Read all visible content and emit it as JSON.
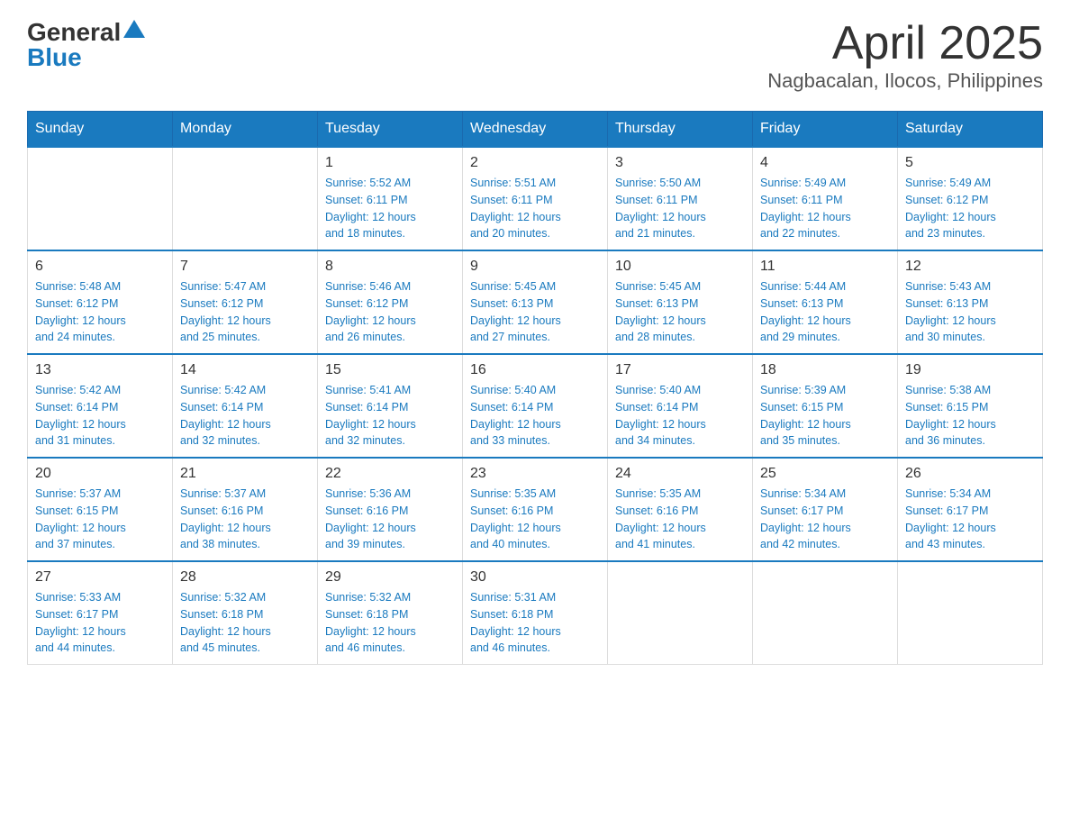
{
  "header": {
    "logo_general": "General",
    "logo_blue": "Blue",
    "title": "April 2025",
    "subtitle": "Nagbacalan, Ilocos, Philippines"
  },
  "weekdays": [
    "Sunday",
    "Monday",
    "Tuesday",
    "Wednesday",
    "Thursday",
    "Friday",
    "Saturday"
  ],
  "weeks": [
    [
      {
        "day": "",
        "info": ""
      },
      {
        "day": "",
        "info": ""
      },
      {
        "day": "1",
        "info": "Sunrise: 5:52 AM\nSunset: 6:11 PM\nDaylight: 12 hours\nand 18 minutes."
      },
      {
        "day": "2",
        "info": "Sunrise: 5:51 AM\nSunset: 6:11 PM\nDaylight: 12 hours\nand 20 minutes."
      },
      {
        "day": "3",
        "info": "Sunrise: 5:50 AM\nSunset: 6:11 PM\nDaylight: 12 hours\nand 21 minutes."
      },
      {
        "day": "4",
        "info": "Sunrise: 5:49 AM\nSunset: 6:11 PM\nDaylight: 12 hours\nand 22 minutes."
      },
      {
        "day": "5",
        "info": "Sunrise: 5:49 AM\nSunset: 6:12 PM\nDaylight: 12 hours\nand 23 minutes."
      }
    ],
    [
      {
        "day": "6",
        "info": "Sunrise: 5:48 AM\nSunset: 6:12 PM\nDaylight: 12 hours\nand 24 minutes."
      },
      {
        "day": "7",
        "info": "Sunrise: 5:47 AM\nSunset: 6:12 PM\nDaylight: 12 hours\nand 25 minutes."
      },
      {
        "day": "8",
        "info": "Sunrise: 5:46 AM\nSunset: 6:12 PM\nDaylight: 12 hours\nand 26 minutes."
      },
      {
        "day": "9",
        "info": "Sunrise: 5:45 AM\nSunset: 6:13 PM\nDaylight: 12 hours\nand 27 minutes."
      },
      {
        "day": "10",
        "info": "Sunrise: 5:45 AM\nSunset: 6:13 PM\nDaylight: 12 hours\nand 28 minutes."
      },
      {
        "day": "11",
        "info": "Sunrise: 5:44 AM\nSunset: 6:13 PM\nDaylight: 12 hours\nand 29 minutes."
      },
      {
        "day": "12",
        "info": "Sunrise: 5:43 AM\nSunset: 6:13 PM\nDaylight: 12 hours\nand 30 minutes."
      }
    ],
    [
      {
        "day": "13",
        "info": "Sunrise: 5:42 AM\nSunset: 6:14 PM\nDaylight: 12 hours\nand 31 minutes."
      },
      {
        "day": "14",
        "info": "Sunrise: 5:42 AM\nSunset: 6:14 PM\nDaylight: 12 hours\nand 32 minutes."
      },
      {
        "day": "15",
        "info": "Sunrise: 5:41 AM\nSunset: 6:14 PM\nDaylight: 12 hours\nand 32 minutes."
      },
      {
        "day": "16",
        "info": "Sunrise: 5:40 AM\nSunset: 6:14 PM\nDaylight: 12 hours\nand 33 minutes."
      },
      {
        "day": "17",
        "info": "Sunrise: 5:40 AM\nSunset: 6:14 PM\nDaylight: 12 hours\nand 34 minutes."
      },
      {
        "day": "18",
        "info": "Sunrise: 5:39 AM\nSunset: 6:15 PM\nDaylight: 12 hours\nand 35 minutes."
      },
      {
        "day": "19",
        "info": "Sunrise: 5:38 AM\nSunset: 6:15 PM\nDaylight: 12 hours\nand 36 minutes."
      }
    ],
    [
      {
        "day": "20",
        "info": "Sunrise: 5:37 AM\nSunset: 6:15 PM\nDaylight: 12 hours\nand 37 minutes."
      },
      {
        "day": "21",
        "info": "Sunrise: 5:37 AM\nSunset: 6:16 PM\nDaylight: 12 hours\nand 38 minutes."
      },
      {
        "day": "22",
        "info": "Sunrise: 5:36 AM\nSunset: 6:16 PM\nDaylight: 12 hours\nand 39 minutes."
      },
      {
        "day": "23",
        "info": "Sunrise: 5:35 AM\nSunset: 6:16 PM\nDaylight: 12 hours\nand 40 minutes."
      },
      {
        "day": "24",
        "info": "Sunrise: 5:35 AM\nSunset: 6:16 PM\nDaylight: 12 hours\nand 41 minutes."
      },
      {
        "day": "25",
        "info": "Sunrise: 5:34 AM\nSunset: 6:17 PM\nDaylight: 12 hours\nand 42 minutes."
      },
      {
        "day": "26",
        "info": "Sunrise: 5:34 AM\nSunset: 6:17 PM\nDaylight: 12 hours\nand 43 minutes."
      }
    ],
    [
      {
        "day": "27",
        "info": "Sunrise: 5:33 AM\nSunset: 6:17 PM\nDaylight: 12 hours\nand 44 minutes."
      },
      {
        "day": "28",
        "info": "Sunrise: 5:32 AM\nSunset: 6:18 PM\nDaylight: 12 hours\nand 45 minutes."
      },
      {
        "day": "29",
        "info": "Sunrise: 5:32 AM\nSunset: 6:18 PM\nDaylight: 12 hours\nand 46 minutes."
      },
      {
        "day": "30",
        "info": "Sunrise: 5:31 AM\nSunset: 6:18 PM\nDaylight: 12 hours\nand 46 minutes."
      },
      {
        "day": "",
        "info": ""
      },
      {
        "day": "",
        "info": ""
      },
      {
        "day": "",
        "info": ""
      }
    ]
  ]
}
